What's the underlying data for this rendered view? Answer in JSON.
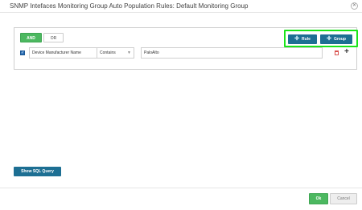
{
  "dialog": {
    "title": "SNMP Intefaces Monitoring Group Auto Population Rules: Default Monitoring Group",
    "close_icon": "close-icon"
  },
  "rules": {
    "and_label": "AND",
    "or_label": "OR",
    "rule_label": "Rule",
    "group_label": "Group",
    "rows": [
      {
        "checked": true,
        "field": "Device Manufacturer Name",
        "operator": "Contains",
        "value": "PaloAlto"
      }
    ]
  },
  "sql_label": "Show SQL Query",
  "footer": {
    "ok_label": "Ok",
    "cancel_label": "Cancel"
  },
  "colors": {
    "accent_green": "#4cb860",
    "button_blue": "#1d6f93",
    "highlight": "#19e519"
  }
}
